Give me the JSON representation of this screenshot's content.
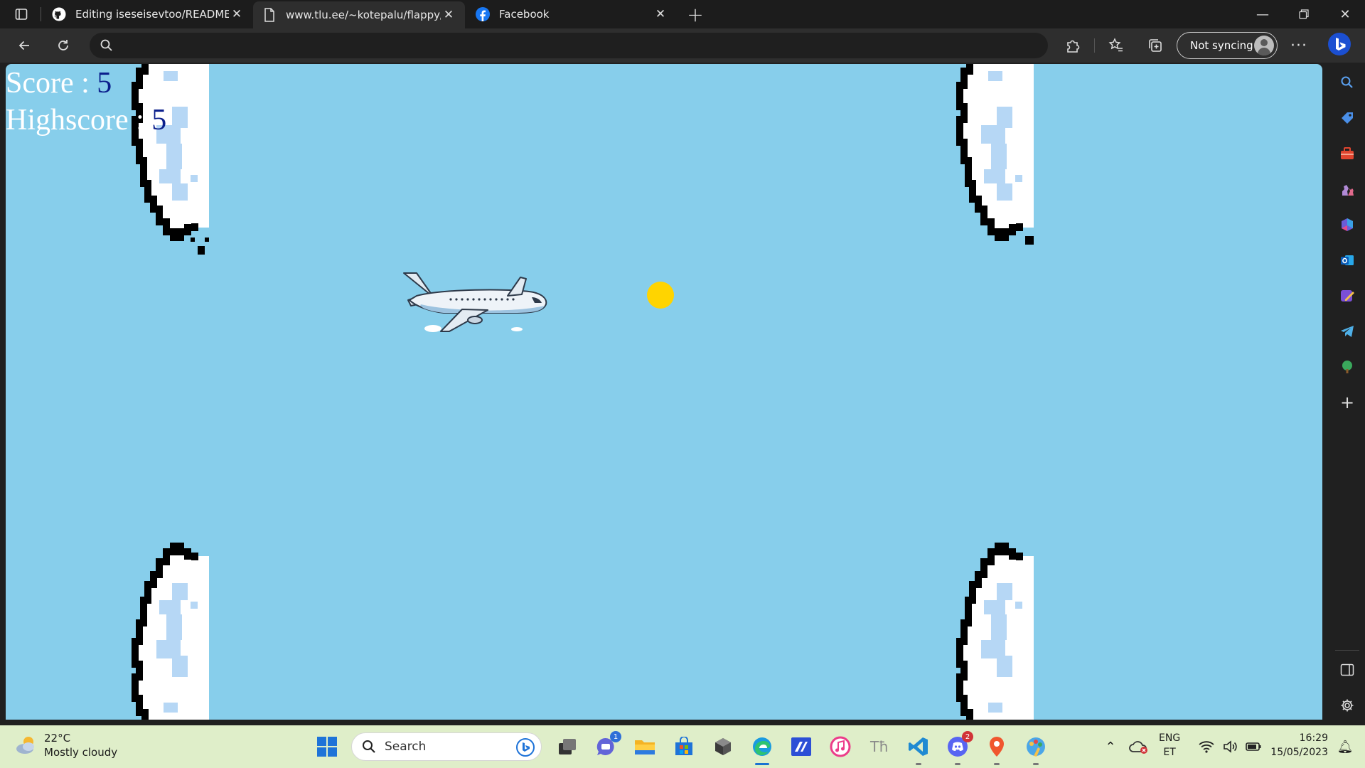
{
  "browser": {
    "tabs": [
      {
        "title": "Editing iseseisevtoo/README.md",
        "favicon": "github-icon",
        "active": false
      },
      {
        "title": "www.tlu.ee/~kotepalu/flappy/flappy.html",
        "favicon": "page-icon",
        "active": true
      },
      {
        "title": "Facebook",
        "favicon": "facebook-icon",
        "active": false
      }
    ],
    "address": {
      "value": "",
      "placeholder": ""
    },
    "sync_label": "Not syncing"
  },
  "game": {
    "score_label": "Score : ",
    "score_value": "5",
    "highscore_label": "Highscore : ",
    "highscore_value": "5",
    "colors": {
      "sky": "#87ceeb",
      "sun": "#ffd400",
      "score_number": "#0b1f8c"
    }
  },
  "taskbar": {
    "weather": {
      "temp": "22°C",
      "condition": "Mostly cloudy"
    },
    "search_label": "Search",
    "badges": {
      "teams": "1",
      "discord": "2"
    },
    "tray": {
      "lang": "ENG",
      "region": "ET",
      "time": "16:29",
      "date": "15/05/2023"
    }
  }
}
